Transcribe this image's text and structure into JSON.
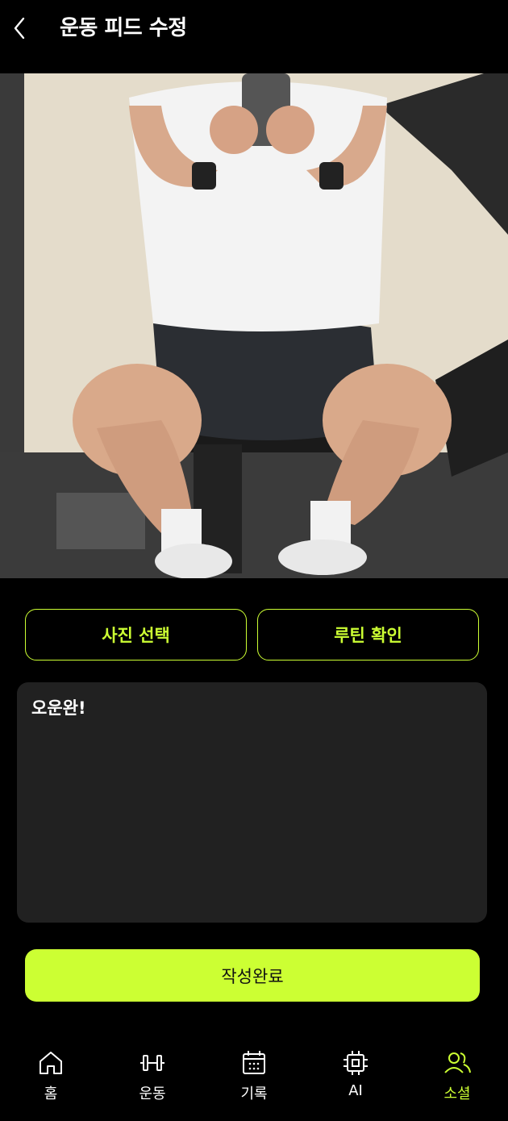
{
  "header": {
    "title": "운동 피드 수정"
  },
  "buttons": {
    "select_photo": "사진 선택",
    "check_routine": "루틴 확인",
    "submit": "작성완료"
  },
  "post": {
    "text": "오운완!"
  },
  "nav": {
    "items": [
      {
        "label": "홈",
        "icon": "home-icon",
        "active": false
      },
      {
        "label": "운동",
        "icon": "dumbbell-icon",
        "active": false
      },
      {
        "label": "기록",
        "icon": "calendar-icon",
        "active": false
      },
      {
        "label": "AI",
        "icon": "chip-icon",
        "active": false
      },
      {
        "label": "소셜",
        "icon": "users-icon",
        "active": true
      }
    ]
  },
  "colors": {
    "accent": "#ccff33",
    "background": "#000000",
    "input_bg": "#212121"
  }
}
